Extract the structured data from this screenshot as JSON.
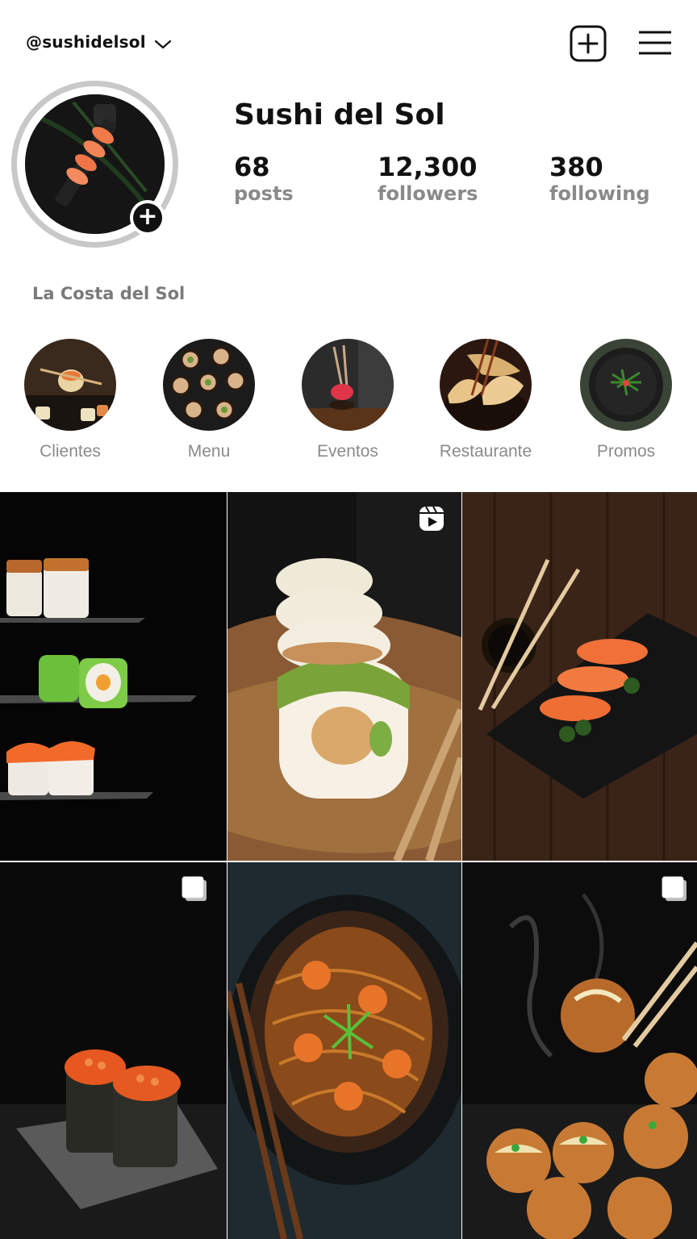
{
  "header": {
    "username": "@sushidelsol",
    "icons": [
      "chevron-down-icon",
      "add-square-icon",
      "hamburger-menu-icon"
    ]
  },
  "profile": {
    "display_name": "Sushi del Sol",
    "stats": {
      "posts_value": "68",
      "posts_label": "posts",
      "followers_value": "12,300",
      "followers_label": "followers",
      "following_value": "380",
      "following_label": "following"
    },
    "bio": "La Costa del Sol"
  },
  "highlights": [
    {
      "label": "Clientes"
    },
    {
      "label": "Menu"
    },
    {
      "label": "Eventos"
    },
    {
      "label": "Restaurante"
    },
    {
      "label": "Promos"
    }
  ],
  "posts": [
    {
      "badge": null
    },
    {
      "badge": "reel-icon"
    },
    {
      "badge": null
    },
    {
      "badge": "multi-photo-icon"
    },
    {
      "badge": null
    },
    {
      "badge": "multi-photo-icon"
    }
  ],
  "colors": {
    "text": "#111111",
    "muted": "#8a8a8a",
    "avatar_ring": "#c8c8c8"
  }
}
